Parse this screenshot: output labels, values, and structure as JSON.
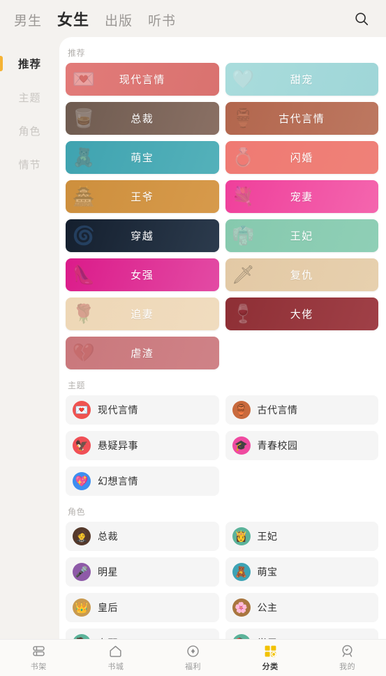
{
  "header": {
    "tabs": [
      {
        "label": "男生",
        "active": false
      },
      {
        "label": "女生",
        "active": true
      },
      {
        "label": "出版",
        "active": false
      },
      {
        "label": "听书",
        "active": false
      }
    ],
    "search_icon": "search-icon"
  },
  "sidebar": {
    "items": [
      {
        "label": "推荐",
        "active": true
      },
      {
        "label": "主题",
        "active": false
      },
      {
        "label": "角色",
        "active": false
      },
      {
        "label": "情节",
        "active": false
      }
    ],
    "active_marker_color": "#f5b335"
  },
  "sections": {
    "recommend": {
      "title": "推荐",
      "cards": [
        {
          "label": "现代言情",
          "c1": "#e27b79",
          "c2": "#d9726f",
          "art": "💌"
        },
        {
          "label": "甜宠",
          "c1": "#a9dcdc",
          "c2": "#9fd6d8",
          "art": "🤍"
        },
        {
          "label": "总裁",
          "c1": "#6e5b50",
          "c2": "#8a7064",
          "art": "🥃"
        },
        {
          "label": "古代言情",
          "c1": "#b2664d",
          "c2": "#bd7861",
          "art": "🏺"
        },
        {
          "label": "萌宝",
          "c1": "#3fa3b0",
          "c2": "#54b1ba",
          "art": "🧸"
        },
        {
          "label": "闪婚",
          "c1": "#ef7a73",
          "c2": "#ef8178",
          "art": "💍"
        },
        {
          "label": "王爷",
          "c1": "#cd8f3d",
          "c2": "#d79a4b",
          "art": "🏯"
        },
        {
          "label": "宠妻",
          "c1": "#ef3f9b",
          "c2": "#f466ae",
          "art": "💐"
        },
        {
          "label": "穿越",
          "c1": "#141f2e",
          "c2": "#2c3b4d",
          "art": "🌀"
        },
        {
          "label": "王妃",
          "c1": "#86c9ae",
          "c2": "#8fcfb6",
          "art": "👘"
        },
        {
          "label": "女强",
          "c1": "#db1b8a",
          "c2": "#e34ba4",
          "art": "👠"
        },
        {
          "label": "复仇",
          "c1": "#e3c9a5",
          "c2": "#e7d0ae",
          "art": "🗡"
        },
        {
          "label": "追妻",
          "c1": "#eed7b6",
          "c2": "#f0dcbf",
          "art": "🌹"
        },
        {
          "label": "大佬",
          "c1": "#8e2f35",
          "c2": "#a04047",
          "art": "🍷"
        },
        {
          "label": "虐渣",
          "c1": "#c9787c",
          "c2": "#cf8287",
          "art": "💔"
        }
      ]
    },
    "theme": {
      "title": "主题",
      "items": [
        {
          "label": "现代言情",
          "icon": "💌",
          "bg": "#ef5350"
        },
        {
          "label": "古代言情",
          "icon": "🏺",
          "bg": "#c96a3d"
        },
        {
          "label": "悬疑异事",
          "icon": "🦅",
          "bg": "#f04f56"
        },
        {
          "label": "青春校园",
          "icon": "🎓",
          "bg": "#ef4aa0"
        },
        {
          "label": "幻想言情",
          "icon": "💖",
          "bg": "#3d8ef0"
        }
      ]
    },
    "role": {
      "title": "角色",
      "items": [
        {
          "label": "总裁",
          "icon": "🤵",
          "bg": "#55392b"
        },
        {
          "label": "王妃",
          "icon": "👸",
          "bg": "#5bb39a"
        },
        {
          "label": "明星",
          "icon": "🎤",
          "bg": "#8e5aa8"
        },
        {
          "label": "萌宝",
          "icon": "🧸",
          "bg": "#3da3b5"
        },
        {
          "label": "皇后",
          "icon": "👑",
          "bg": "#c99a4e"
        },
        {
          "label": "公主",
          "icon": "🌸",
          "bg": "#a9763f"
        },
        {
          "label": "女配",
          "icon": "💁",
          "bg": "#5bb39a"
        },
        {
          "label": "学霸",
          "icon": "📚",
          "bg": "#5bb39a"
        }
      ]
    }
  },
  "tabbar": {
    "items": [
      {
        "label": "书架",
        "icon": "bookshelf-icon",
        "active": false
      },
      {
        "label": "书城",
        "icon": "home-icon",
        "active": false
      },
      {
        "label": "福利",
        "icon": "gift-icon",
        "active": false
      },
      {
        "label": "分类",
        "icon": "grid-icon",
        "active": true
      },
      {
        "label": "我的",
        "icon": "person-icon",
        "active": false
      }
    ],
    "active_color": "#f2c200"
  }
}
